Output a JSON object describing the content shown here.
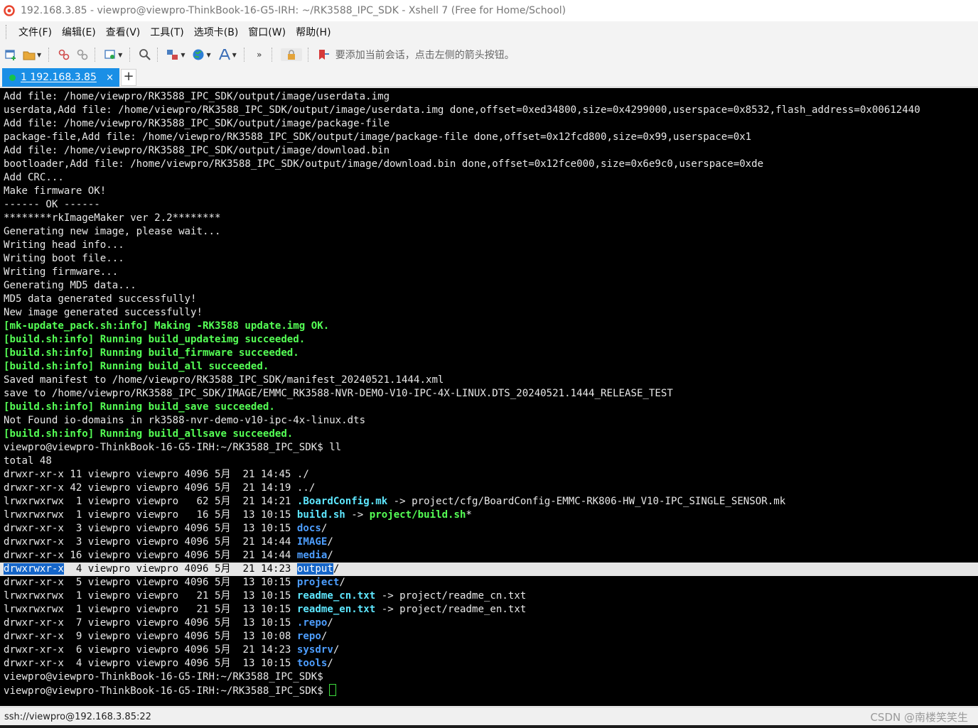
{
  "window": {
    "title": "192.168.3.85 - viewpro@viewpro-ThinkBook-16-G5-IRH: ~/RK3588_IPC_SDK - Xshell 7 (Free for Home/School)"
  },
  "menu": [
    "文件(F)",
    "编辑(E)",
    "查看(V)",
    "工具(T)",
    "选项卡(B)",
    "窗口(W)",
    "帮助(H)"
  ],
  "toolbar": {
    "icons": [
      "new-session-icon",
      "open-folder-icon",
      "disconnect-icon",
      "reconnect-icon",
      "properties-icon",
      "find-icon",
      "transfer-icon",
      "globe-icon",
      "font-icon",
      "more-icon",
      "lock-icon",
      "bookmark-icon"
    ],
    "hint": "要添加当前会话，点击左侧的箭头按钮。"
  },
  "tabs": [
    {
      "label": "1 192.168.3.85",
      "close": "×",
      "status_color": "#16c34c"
    }
  ],
  "new_tab": "+",
  "terminal": {
    "colors": {
      "background": "#000000",
      "text": "#e8e8e8",
      "green": "#55ff55",
      "cyan": "#5ee7ff",
      "blue": "#4d9eff",
      "selection": "#1565c8"
    },
    "lines": [
      {
        "segments": [
          {
            "text": "Add file: /home/viewpro/RK3588_IPC_SDK/output/image/userdata.img"
          }
        ]
      },
      {
        "segments": [
          {
            "text": "userdata,Add file: /home/viewpro/RK3588_IPC_SDK/output/image/userdata.img done,offset=0xed34800,size=0x4299000,userspace=0x8532,flash_address=0x00612440"
          }
        ]
      },
      {
        "segments": [
          {
            "text": "Add file: /home/viewpro/RK3588_IPC_SDK/output/image/package-file"
          }
        ]
      },
      {
        "segments": [
          {
            "text": "package-file,Add file: /home/viewpro/RK3588_IPC_SDK/output/image/package-file done,offset=0x12fcd800,size=0x99,userspace=0x1"
          }
        ]
      },
      {
        "segments": [
          {
            "text": "Add file: /home/viewpro/RK3588_IPC_SDK/output/image/download.bin"
          }
        ]
      },
      {
        "segments": [
          {
            "text": "bootloader,Add file: /home/viewpro/RK3588_IPC_SDK/output/image/download.bin done,offset=0x12fce000,size=0x6e9c0,userspace=0xde"
          }
        ]
      },
      {
        "segments": [
          {
            "text": "Add CRC..."
          }
        ]
      },
      {
        "segments": [
          {
            "text": "Make firmware OK!"
          }
        ]
      },
      {
        "segments": [
          {
            "text": "------ OK ------"
          }
        ]
      },
      {
        "segments": [
          {
            "text": "********rkImageMaker ver 2.2********"
          }
        ]
      },
      {
        "segments": [
          {
            "text": "Generating new image, please wait..."
          }
        ]
      },
      {
        "segments": [
          {
            "text": "Writing head info..."
          }
        ]
      },
      {
        "segments": [
          {
            "text": "Writing boot file..."
          }
        ]
      },
      {
        "segments": [
          {
            "text": "Writing firmware..."
          }
        ]
      },
      {
        "segments": [
          {
            "text": "Generating MD5 data..."
          }
        ]
      },
      {
        "segments": [
          {
            "text": "MD5 data generated successfully!"
          }
        ]
      },
      {
        "segments": [
          {
            "text": "New image generated successfully!"
          }
        ]
      },
      {
        "segments": [
          {
            "text": "[mk-update_pack.sh:info] Making -RK3588 update.img OK.",
            "cls": "green"
          }
        ]
      },
      {
        "segments": [
          {
            "text": "[build.sh:info] Running build_updateimg succeeded.",
            "cls": "green"
          }
        ]
      },
      {
        "segments": [
          {
            "text": "[build.sh:info] Running build_firmware succeeded.",
            "cls": "green"
          }
        ]
      },
      {
        "segments": [
          {
            "text": "[build.sh:info] Running build_all succeeded.",
            "cls": "green"
          }
        ]
      },
      {
        "segments": [
          {
            "text": "Saved manifest to /home/viewpro/RK3588_IPC_SDK/manifest_20240521.1444.xml"
          }
        ]
      },
      {
        "segments": [
          {
            "text": "save to /home/viewpro/RK3588_IPC_SDK/IMAGE/EMMC_RK3588-NVR-DEMO-V10-IPC-4X-LINUX.DTS_20240521.1444_RELEASE_TEST"
          }
        ]
      },
      {
        "segments": [
          {
            "text": "[build.sh:info] Running build_save succeeded.",
            "cls": "green"
          }
        ]
      },
      {
        "segments": [
          {
            "text": "Not Found io-domains in rk3588-nvr-demo-v10-ipc-4x-linux.dts"
          }
        ]
      },
      {
        "segments": [
          {
            "text": "[build.sh:info] Running build_allsave succeeded.",
            "cls": "green"
          }
        ]
      },
      {
        "segments": [
          {
            "text": "viewpro@viewpro-ThinkBook-16-G5-IRH:~/RK3588_IPC_SDK$ ll"
          }
        ]
      },
      {
        "segments": [
          {
            "text": "total 48"
          }
        ]
      },
      {
        "segments": [
          {
            "text": "drwxr-xr-x 11 viewpro viewpro 4096 5月  21 14:45 ./"
          }
        ]
      },
      {
        "segments": [
          {
            "text": "drwxr-xr-x 42 viewpro viewpro 4096 5月  21 14:19 ../"
          }
        ]
      },
      {
        "segments": [
          {
            "text": "lrwxrwxrwx  1 viewpro viewpro   62 5月  21 14:21 "
          },
          {
            "text": ".BoardConfig.mk",
            "cls": "fcyan"
          },
          {
            "text": " -> project/cfg/BoardConfig-EMMC-RK806-HW_V10-IPC_SINGLE_SENSOR.mk"
          }
        ]
      },
      {
        "segments": [
          {
            "text": "lrwxrwxrwx  1 viewpro viewpro   16 5月  13 10:15 "
          },
          {
            "text": "build.sh",
            "cls": "fcyan"
          },
          {
            "text": " -> "
          },
          {
            "text": "project/build.sh",
            "cls": "fgreen"
          },
          {
            "text": "*"
          }
        ]
      },
      {
        "segments": [
          {
            "text": "drwxr-xr-x  3 viewpro viewpro 4096 5月  13 10:15 "
          },
          {
            "text": "docs",
            "cls": "fblue"
          },
          {
            "text": "/"
          }
        ]
      },
      {
        "segments": [
          {
            "text": "drwxrwxr-x  3 viewpro viewpro 4096 5月  21 14:44 "
          },
          {
            "text": "IMAGE",
            "cls": "fblue"
          },
          {
            "text": "/"
          }
        ]
      },
      {
        "segments": [
          {
            "text": "drwxr-xr-x 16 viewpro viewpro 4096 5月  21 14:44 "
          },
          {
            "text": "media",
            "cls": "fblue"
          },
          {
            "text": "/"
          }
        ]
      },
      {
        "highlight": true,
        "segments": [
          {
            "text": "drwxrwxr-x",
            "cls": "sel"
          },
          {
            "text": "  4 viewpro viewpro 4096 5月  21 14:23 "
          },
          {
            "text": "output",
            "cls": "sel"
          },
          {
            "text": "/"
          }
        ]
      },
      {
        "segments": [
          {
            "text": "drwxr-xr-x  5 viewpro viewpro 4096 5月  13 10:15 "
          },
          {
            "text": "project",
            "cls": "fblue"
          },
          {
            "text": "/"
          }
        ]
      },
      {
        "segments": [
          {
            "text": "lrwxrwxrwx  1 viewpro viewpro   21 5月  13 10:15 "
          },
          {
            "text": "readme_cn.txt",
            "cls": "fcyan"
          },
          {
            "text": " -> project/readme_cn.txt"
          }
        ]
      },
      {
        "segments": [
          {
            "text": "lrwxrwxrwx  1 viewpro viewpro   21 5月  13 10:15 "
          },
          {
            "text": "readme_en.txt",
            "cls": "fcyan"
          },
          {
            "text": " -> project/readme_en.txt"
          }
        ]
      },
      {
        "segments": [
          {
            "text": "drwxr-xr-x  7 viewpro viewpro 4096 5月  13 10:15 "
          },
          {
            "text": ".repo",
            "cls": "fblue"
          },
          {
            "text": "/"
          }
        ]
      },
      {
        "segments": [
          {
            "text": "drwxr-xr-x  9 viewpro viewpro 4096 5月  13 10:08 "
          },
          {
            "text": "repo",
            "cls": "fblue"
          },
          {
            "text": "/"
          }
        ]
      },
      {
        "segments": [
          {
            "text": "drwxr-xr-x  6 viewpro viewpro 4096 5月  21 14:23 "
          },
          {
            "text": "sysdrv",
            "cls": "fblue"
          },
          {
            "text": "/"
          }
        ]
      },
      {
        "segments": [
          {
            "text": "drwxr-xr-x  4 viewpro viewpro 4096 5月  13 10:15 "
          },
          {
            "text": "tools",
            "cls": "fblue"
          },
          {
            "text": "/"
          }
        ]
      },
      {
        "segments": [
          {
            "text": "viewpro@viewpro-ThinkBook-16-G5-IRH:~/RK3588_IPC_SDK$"
          }
        ]
      },
      {
        "segments": [
          {
            "text": "viewpro@viewpro-ThinkBook-16-G5-IRH:~/RK3588_IPC_SDK$ "
          }
        ],
        "cursor": true
      }
    ]
  },
  "status": {
    "connection": "ssh://viewpro@192.168.3.85:22",
    "watermark": "CSDN @南楼笑笑生"
  }
}
